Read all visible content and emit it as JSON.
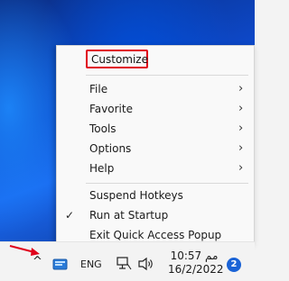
{
  "menu": {
    "customize": "Customize",
    "items": [
      {
        "label": "File",
        "submenu": true
      },
      {
        "label": "Favorite",
        "submenu": true
      },
      {
        "label": "Tools",
        "submenu": true
      },
      {
        "label": "Options",
        "submenu": true
      },
      {
        "label": "Help",
        "submenu": true
      }
    ],
    "suspend_hotkeys": "Suspend Hotkeys",
    "run_at_startup": "Run at Startup",
    "run_at_startup_checked": true,
    "exit": "Exit Quick Access Popup",
    "chevron_glyph": "›",
    "check_glyph": "✓"
  },
  "taskbar": {
    "show_hidden_glyph": "^",
    "language": "ENG",
    "time": "10:57 مم",
    "date": "16/2/2022",
    "notification_count": "2",
    "icons": [
      "chevron-up-icon",
      "qap-tray-icon",
      "network-icon",
      "volume-icon"
    ]
  },
  "highlight_color": "#e0001b",
  "arrow_color": "#e0001b"
}
